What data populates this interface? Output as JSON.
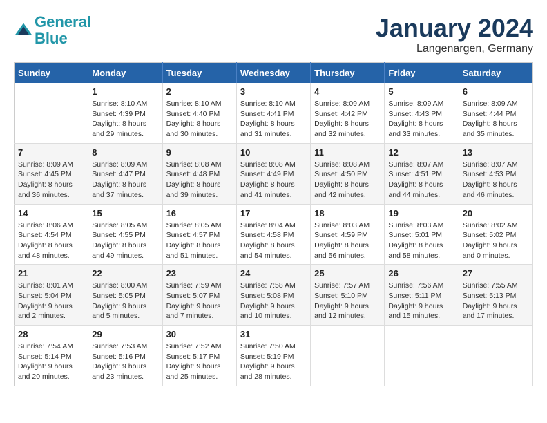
{
  "header": {
    "logo_line1": "General",
    "logo_line2": "Blue",
    "month": "January 2024",
    "location": "Langenargen, Germany"
  },
  "weekdays": [
    "Sunday",
    "Monday",
    "Tuesday",
    "Wednesday",
    "Thursday",
    "Friday",
    "Saturday"
  ],
  "weeks": [
    [
      {
        "day": "",
        "info": ""
      },
      {
        "day": "1",
        "info": "Sunrise: 8:10 AM\nSunset: 4:39 PM\nDaylight: 8 hours\nand 29 minutes."
      },
      {
        "day": "2",
        "info": "Sunrise: 8:10 AM\nSunset: 4:40 PM\nDaylight: 8 hours\nand 30 minutes."
      },
      {
        "day": "3",
        "info": "Sunrise: 8:10 AM\nSunset: 4:41 PM\nDaylight: 8 hours\nand 31 minutes."
      },
      {
        "day": "4",
        "info": "Sunrise: 8:09 AM\nSunset: 4:42 PM\nDaylight: 8 hours\nand 32 minutes."
      },
      {
        "day": "5",
        "info": "Sunrise: 8:09 AM\nSunset: 4:43 PM\nDaylight: 8 hours\nand 33 minutes."
      },
      {
        "day": "6",
        "info": "Sunrise: 8:09 AM\nSunset: 4:44 PM\nDaylight: 8 hours\nand 35 minutes."
      }
    ],
    [
      {
        "day": "7",
        "info": "Sunrise: 8:09 AM\nSunset: 4:45 PM\nDaylight: 8 hours\nand 36 minutes."
      },
      {
        "day": "8",
        "info": "Sunrise: 8:09 AM\nSunset: 4:47 PM\nDaylight: 8 hours\nand 37 minutes."
      },
      {
        "day": "9",
        "info": "Sunrise: 8:08 AM\nSunset: 4:48 PM\nDaylight: 8 hours\nand 39 minutes."
      },
      {
        "day": "10",
        "info": "Sunrise: 8:08 AM\nSunset: 4:49 PM\nDaylight: 8 hours\nand 41 minutes."
      },
      {
        "day": "11",
        "info": "Sunrise: 8:08 AM\nSunset: 4:50 PM\nDaylight: 8 hours\nand 42 minutes."
      },
      {
        "day": "12",
        "info": "Sunrise: 8:07 AM\nSunset: 4:51 PM\nDaylight: 8 hours\nand 44 minutes."
      },
      {
        "day": "13",
        "info": "Sunrise: 8:07 AM\nSunset: 4:53 PM\nDaylight: 8 hours\nand 46 minutes."
      }
    ],
    [
      {
        "day": "14",
        "info": "Sunrise: 8:06 AM\nSunset: 4:54 PM\nDaylight: 8 hours\nand 48 minutes."
      },
      {
        "day": "15",
        "info": "Sunrise: 8:05 AM\nSunset: 4:55 PM\nDaylight: 8 hours\nand 49 minutes."
      },
      {
        "day": "16",
        "info": "Sunrise: 8:05 AM\nSunset: 4:57 PM\nDaylight: 8 hours\nand 51 minutes."
      },
      {
        "day": "17",
        "info": "Sunrise: 8:04 AM\nSunset: 4:58 PM\nDaylight: 8 hours\nand 54 minutes."
      },
      {
        "day": "18",
        "info": "Sunrise: 8:03 AM\nSunset: 4:59 PM\nDaylight: 8 hours\nand 56 minutes."
      },
      {
        "day": "19",
        "info": "Sunrise: 8:03 AM\nSunset: 5:01 PM\nDaylight: 8 hours\nand 58 minutes."
      },
      {
        "day": "20",
        "info": "Sunrise: 8:02 AM\nSunset: 5:02 PM\nDaylight: 9 hours\nand 0 minutes."
      }
    ],
    [
      {
        "day": "21",
        "info": "Sunrise: 8:01 AM\nSunset: 5:04 PM\nDaylight: 9 hours\nand 2 minutes."
      },
      {
        "day": "22",
        "info": "Sunrise: 8:00 AM\nSunset: 5:05 PM\nDaylight: 9 hours\nand 5 minutes."
      },
      {
        "day": "23",
        "info": "Sunrise: 7:59 AM\nSunset: 5:07 PM\nDaylight: 9 hours\nand 7 minutes."
      },
      {
        "day": "24",
        "info": "Sunrise: 7:58 AM\nSunset: 5:08 PM\nDaylight: 9 hours\nand 10 minutes."
      },
      {
        "day": "25",
        "info": "Sunrise: 7:57 AM\nSunset: 5:10 PM\nDaylight: 9 hours\nand 12 minutes."
      },
      {
        "day": "26",
        "info": "Sunrise: 7:56 AM\nSunset: 5:11 PM\nDaylight: 9 hours\nand 15 minutes."
      },
      {
        "day": "27",
        "info": "Sunrise: 7:55 AM\nSunset: 5:13 PM\nDaylight: 9 hours\nand 17 minutes."
      }
    ],
    [
      {
        "day": "28",
        "info": "Sunrise: 7:54 AM\nSunset: 5:14 PM\nDaylight: 9 hours\nand 20 minutes."
      },
      {
        "day": "29",
        "info": "Sunrise: 7:53 AM\nSunset: 5:16 PM\nDaylight: 9 hours\nand 23 minutes."
      },
      {
        "day": "30",
        "info": "Sunrise: 7:52 AM\nSunset: 5:17 PM\nDaylight: 9 hours\nand 25 minutes."
      },
      {
        "day": "31",
        "info": "Sunrise: 7:50 AM\nSunset: 5:19 PM\nDaylight: 9 hours\nand 28 minutes."
      },
      {
        "day": "",
        "info": ""
      },
      {
        "day": "",
        "info": ""
      },
      {
        "day": "",
        "info": ""
      }
    ]
  ]
}
